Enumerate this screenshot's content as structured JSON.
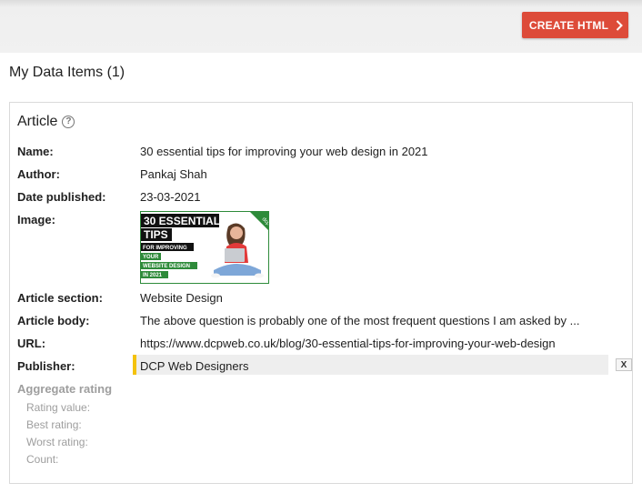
{
  "toolbar": {
    "create_label": "CREATE HTML"
  },
  "section_title": "My Data Items (1)",
  "card": {
    "title": "Article",
    "fields": {
      "name": {
        "label": "Name:",
        "value": "30 essential tips for improving your web design in 2021"
      },
      "author": {
        "label": "Author:",
        "value": "Pankaj Shah"
      },
      "date": {
        "label": "Date published:",
        "value": "23-03-2021"
      },
      "image": {
        "label": "Image:"
      },
      "section": {
        "label": "Article section:",
        "value": "Website Design"
      },
      "body": {
        "label": "Article body:",
        "value": "The above question is probably one of the most frequent questions I am asked by ..."
      },
      "url": {
        "label": "URL:",
        "value": "https://www.dcpweb.co.uk/blog/30-essential-tips-for-improving-your-web-design"
      },
      "publisher": {
        "label": "Publisher:",
        "value": "DCP Web Designers"
      }
    },
    "remove_label": "X",
    "aggregate": {
      "title": "Aggregate rating",
      "rating_value": "Rating value:",
      "best_rating": "Best rating:",
      "worst_rating": "Worst rating:",
      "count": "Count:"
    },
    "thumbnail": {
      "line1": "30 ESSENTIAL",
      "line2": "TIPS",
      "line3": "FOR IMPROVING",
      "line4": "YOUR",
      "line5": "WEBSITE DESIGN",
      "line6": "IN 2021",
      "corner": "dcp"
    }
  },
  "colors": {
    "accent": "#dd4b39",
    "publisher_marker": "#f4c20d",
    "thumbnail_green": "#2e8b3a"
  }
}
